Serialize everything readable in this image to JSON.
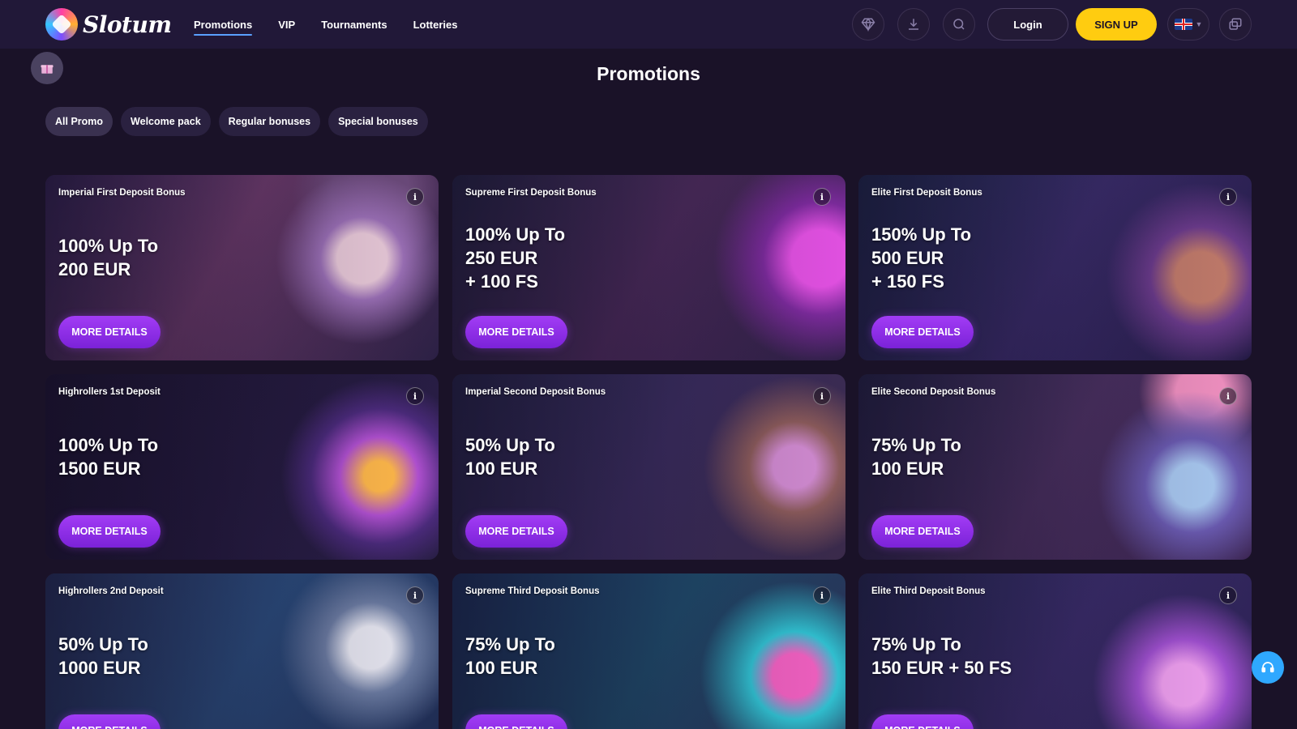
{
  "header": {
    "logo_text": "Slotum",
    "nav": [
      {
        "label": "Promotions",
        "active": true
      },
      {
        "label": "VIP",
        "active": false
      },
      {
        "label": "Tournaments",
        "active": false
      },
      {
        "label": "Lotteries",
        "active": false
      }
    ],
    "login_label": "Login",
    "signup_label": "SIGN UP",
    "icons": [
      "diamond-icon",
      "download-icon",
      "search-icon",
      "language-flag-icon",
      "chat-icon"
    ],
    "language": "uk-flag-icon"
  },
  "page_title": "Promotions",
  "filters": [
    {
      "label": "All Promo",
      "active": true
    },
    {
      "label": "Welcome pack",
      "active": false
    },
    {
      "label": "Regular bonuses",
      "active": false
    },
    {
      "label": "Special bonuses",
      "active": false
    }
  ],
  "cards": [
    {
      "title": "Imperial First Deposit Bonus",
      "offer": "100% Up To\n200 EUR",
      "button": "MORE DETAILS"
    },
    {
      "title": "Supreme First Deposit Bonus",
      "offer": "100% Up To\n250 EUR\n+ 100 FS",
      "button": "MORE DETAILS"
    },
    {
      "title": "Elite First Deposit Bonus",
      "offer": "150% Up To\n500 EUR\n+ 150 FS",
      "button": "MORE DETAILS"
    },
    {
      "title": "Highrollers 1st Deposit",
      "offer": "100% Up To\n1500 EUR",
      "button": "MORE DETAILS"
    },
    {
      "title": "Imperial Second Deposit Bonus",
      "offer": "50% Up To\n100 EUR",
      "button": "MORE DETAILS"
    },
    {
      "title": "Elite Second Deposit Bonus",
      "offer": "75% Up To\n100 EUR",
      "button": "MORE DETAILS"
    },
    {
      "title": "Highrollers 2nd Deposit",
      "offer": "50% Up To\n1000 EUR",
      "button": "MORE DETAILS"
    },
    {
      "title": "Supreme Third Deposit Bonus",
      "offer": "75% Up To\n100 EUR",
      "button": "MORE DETAILS"
    },
    {
      "title": "Elite Third Deposit Bonus",
      "offer": "75% Up To\n150 EUR + 50 FS",
      "button": "MORE DETAILS"
    }
  ],
  "info_glyph": "i",
  "colors": {
    "background": "#1a1228",
    "header": "#211838",
    "signup": "#ffcc10",
    "button_purple": "#8a2be2",
    "support": "#2fa8ff"
  }
}
